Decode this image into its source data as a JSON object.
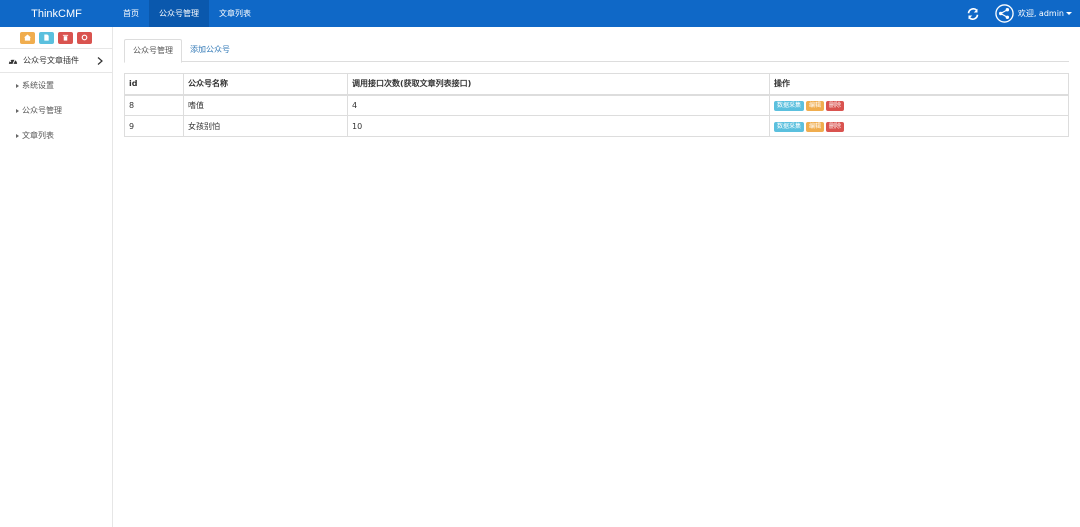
{
  "navbar": {
    "brand": "ThinkCMF",
    "items": [
      {
        "label": "首页",
        "active": false
      },
      {
        "label": "公众号管理",
        "active": true
      },
      {
        "label": "文章列表",
        "active": false
      }
    ],
    "user_greeting": "欢迎, admin",
    "icons": [
      "refresh-icon",
      "share-icon"
    ]
  },
  "sidebar": {
    "shortcut_icons": [
      "home-icon",
      "file-icon",
      "trash-icon",
      "recycle-icon"
    ],
    "section_title": "公众号文章插件",
    "items": [
      {
        "label": "系统设置"
      },
      {
        "label": "公众号管理"
      },
      {
        "label": "文章列表"
      }
    ]
  },
  "tabs": [
    {
      "label": "公众号管理",
      "active": true
    },
    {
      "label": "添加公众号",
      "active": false
    }
  ],
  "table": {
    "headers": [
      "id",
      "公众号名称",
      "调用接口次数(获取文章列表接口)",
      "操作"
    ],
    "rows": [
      {
        "id": "8",
        "name": "嗜值",
        "calls": "4"
      },
      {
        "id": "9",
        "name": "女孩别怕",
        "calls": "10"
      }
    ],
    "actions": {
      "collect": "数据采集",
      "edit": "编辑",
      "delete": "删除"
    }
  },
  "colors": {
    "navbar": "#0f68c7",
    "info": "#5bc0de",
    "warning": "#f0ad4e",
    "danger": "#d9534f"
  }
}
